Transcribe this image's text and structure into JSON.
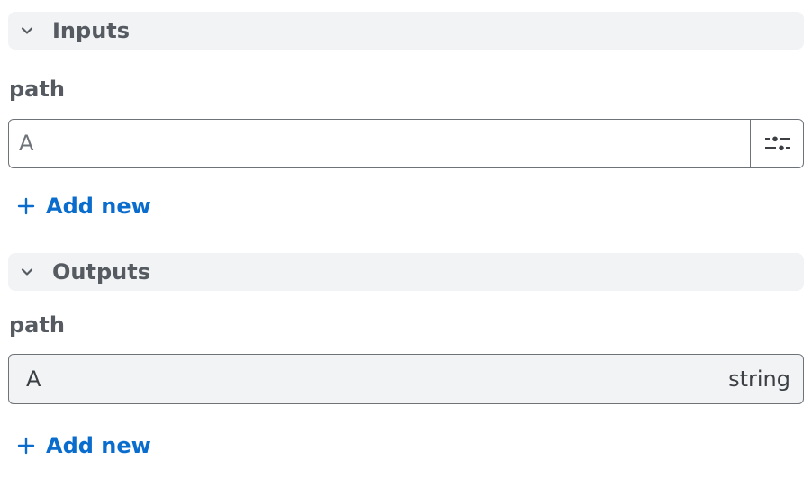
{
  "inputs": {
    "header": {
      "title": "Inputs",
      "icon": "chevron-down-icon"
    },
    "field": {
      "label": "path",
      "value": "A"
    },
    "add_new": {
      "label": "Add new",
      "icon": "plus-icon"
    },
    "filter_icon": "sliders-icon"
  },
  "outputs": {
    "header": {
      "title": "Outputs",
      "icon": "chevron-down-icon"
    },
    "field": {
      "label": "path",
      "value": "A",
      "type": "string"
    },
    "add_new": {
      "label": "Add new",
      "icon": "plus-icon"
    }
  },
  "colors": {
    "accent": "#0a6ccc",
    "header_bg": "#f2f3f5",
    "border": "#6e7378",
    "text": "#3b3f44"
  }
}
